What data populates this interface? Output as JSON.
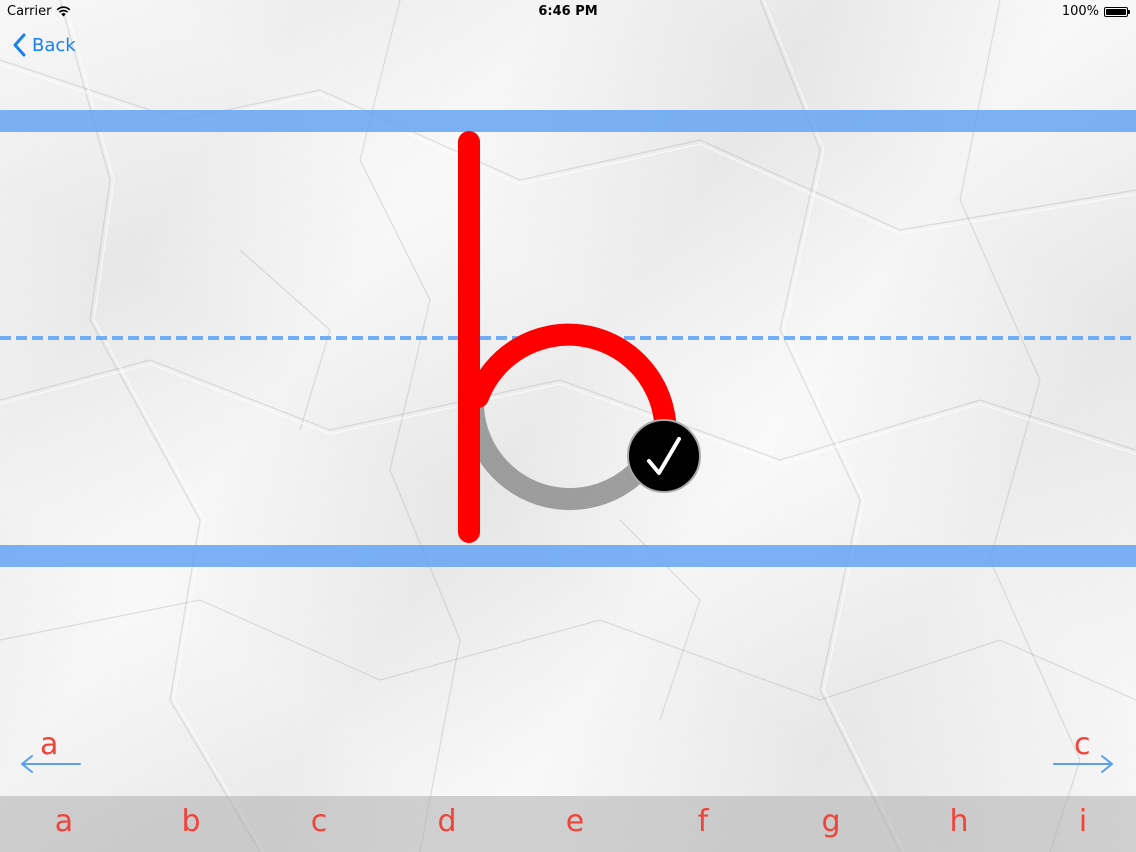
{
  "status_bar": {
    "carrier": "Carrier",
    "time": "6:46 PM",
    "battery": "100%",
    "wifi_icon": "wifi-icon",
    "battery_icon": "battery-icon"
  },
  "nav": {
    "back_label": "Back",
    "back_icon": "chevron-left-icon",
    "prev_letter": "a",
    "next_letter": "c",
    "prev_icon": "arrow-left-icon",
    "next_icon": "arrow-right-icon"
  },
  "practice": {
    "letter": "b",
    "done_icon": "checkmark-icon",
    "colors": {
      "traced": "#ff0000",
      "guide": "#8f8f8f",
      "rule": "#64a5f5"
    }
  },
  "letter_bar": {
    "letters": [
      "a",
      "b",
      "c",
      "d",
      "e",
      "f",
      "g",
      "h",
      "i"
    ],
    "color": "#f0443b"
  }
}
